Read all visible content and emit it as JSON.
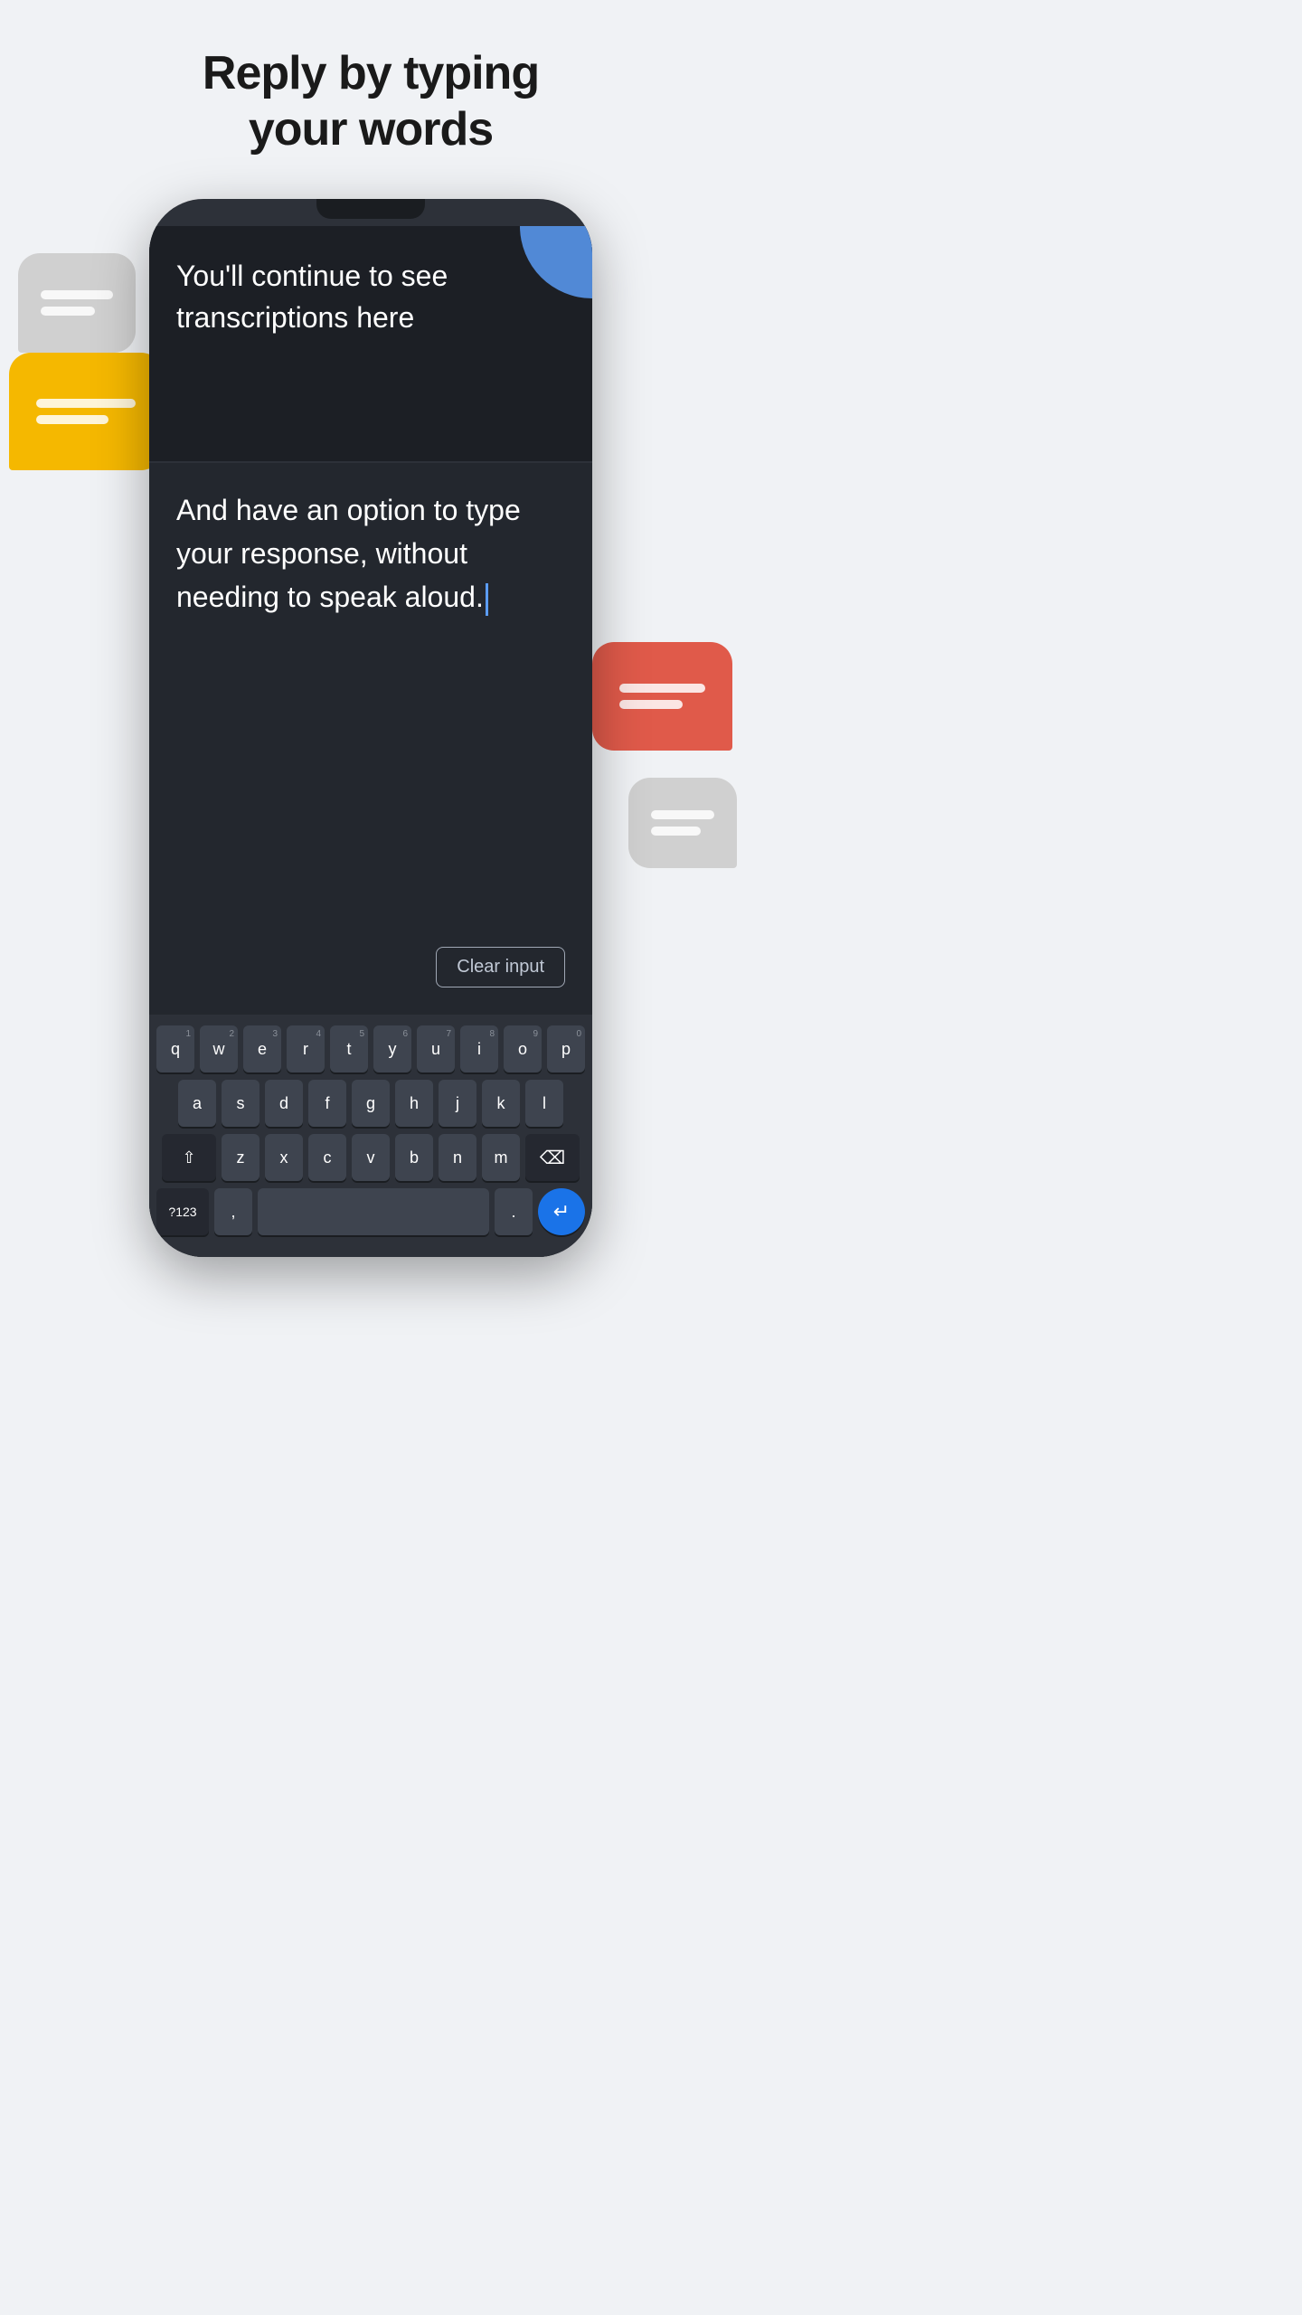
{
  "page": {
    "title_line1": "Reply by typing",
    "title_line2": "your words",
    "background_color": "#f0f2f5"
  },
  "bubbles": {
    "gray_top": {
      "color": "#cccccc"
    },
    "yellow": {
      "color": "#f5b800"
    },
    "red": {
      "color": "#e05a4a"
    },
    "gray_bottom": {
      "color": "#cccccc"
    }
  },
  "phone": {
    "transcription": {
      "text": "You'll continue to see transcriptions here",
      "accent_color": "#5b9cf6"
    },
    "typing": {
      "text": "And have an option to type your response, without needing to speak aloud.",
      "cursor_color": "#5b9cf6"
    },
    "clear_button": {
      "label": "Clear input"
    },
    "keyboard": {
      "rows": [
        {
          "keys": [
            {
              "letter": "q",
              "number": "1"
            },
            {
              "letter": "w",
              "number": "2"
            },
            {
              "letter": "e",
              "number": "3"
            },
            {
              "letter": "r",
              "number": "4"
            },
            {
              "letter": "t",
              "number": "5"
            },
            {
              "letter": "y",
              "number": "6"
            },
            {
              "letter": "u",
              "number": "7"
            },
            {
              "letter": "i",
              "number": "8"
            },
            {
              "letter": "o",
              "number": "9"
            },
            {
              "letter": "p",
              "number": "0"
            }
          ]
        },
        {
          "keys": [
            {
              "letter": "a"
            },
            {
              "letter": "s"
            },
            {
              "letter": "d"
            },
            {
              "letter": "f"
            },
            {
              "letter": "g"
            },
            {
              "letter": "h"
            },
            {
              "letter": "j"
            },
            {
              "letter": "k"
            },
            {
              "letter": "l"
            }
          ]
        },
        {
          "keys": [
            {
              "letter": "shift",
              "special": true
            },
            {
              "letter": "z"
            },
            {
              "letter": "x"
            },
            {
              "letter": "c"
            },
            {
              "letter": "v"
            },
            {
              "letter": "b"
            },
            {
              "letter": "n"
            },
            {
              "letter": "m"
            },
            {
              "letter": "backspace",
              "special": true
            }
          ]
        },
        {
          "keys": [
            {
              "letter": "?123",
              "special": true
            },
            {
              "letter": ","
            },
            {
              "letter": "space",
              "special": true
            },
            {
              "letter": "."
            },
            {
              "letter": "return",
              "special": true
            }
          ]
        }
      ]
    }
  }
}
